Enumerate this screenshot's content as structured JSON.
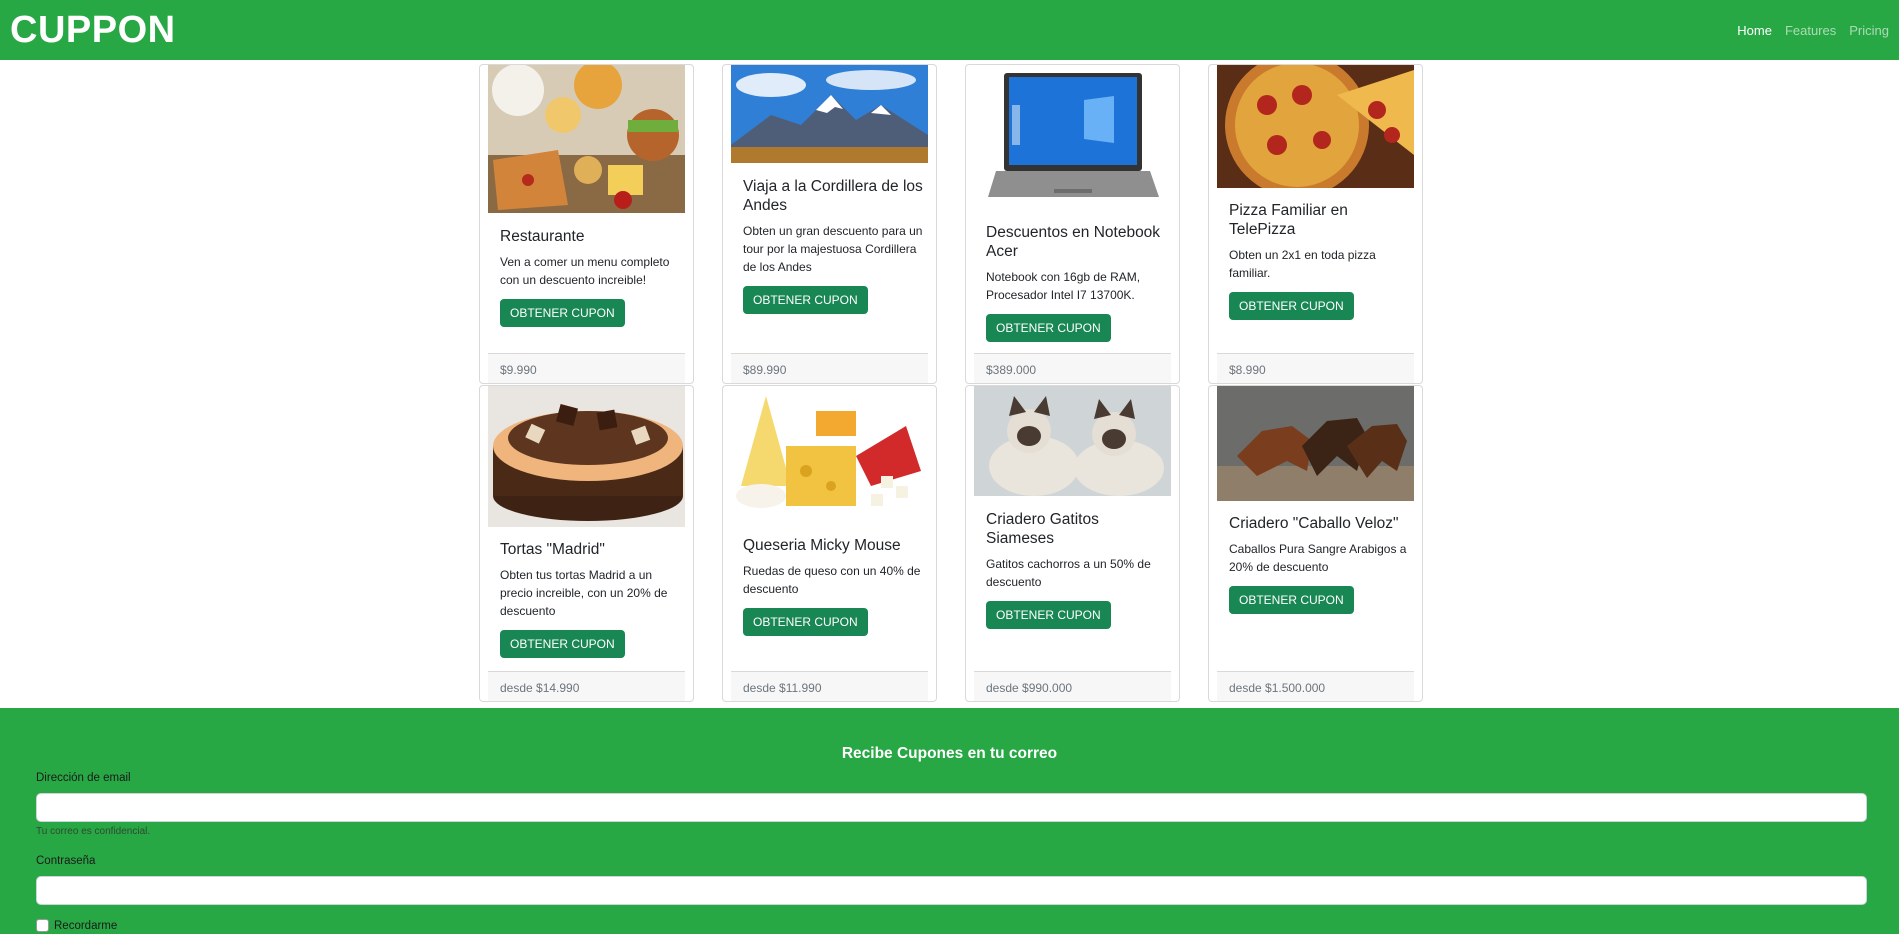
{
  "navbar": {
    "brand": "CUPPON",
    "links": [
      {
        "label": "Home"
      },
      {
        "label": "Features"
      },
      {
        "label": "Pricing"
      }
    ]
  },
  "cards": [
    {
      "title": "Restaurante",
      "text": "Ven a comer un menu completo con un descuento increible!",
      "button": "OBTENER CUPON",
      "price": "$9.990",
      "image": "fast-food-image"
    },
    {
      "title": "Viaja a la Cordillera de los Andes",
      "text": "Obten un gran descuento para un tour por la majestuosa Cordillera de los Andes",
      "button": "OBTENER CUPON",
      "price": "$89.990",
      "image": "mountain-image"
    },
    {
      "title": "Descuentos en Notebook Acer",
      "text": "Notebook con 16gb de RAM, Procesador Intel I7 13700K.",
      "button": "OBTENER CUPON",
      "price": "$389.000",
      "image": "laptop-image"
    },
    {
      "title": "Pizza Familiar en TelePizza",
      "text": "Obten un 2x1 en toda pizza familiar.",
      "button": "OBTENER CUPON",
      "price": "$8.990",
      "image": "pizza-image"
    },
    {
      "title": "Tortas \"Madrid\"",
      "text": "Obten tus tortas Madrid a un precio increible, con un 20% de descuento",
      "button": "OBTENER CUPON",
      "price": "desde $14.990",
      "image": "cake-image"
    },
    {
      "title": "Queseria Micky Mouse",
      "text": "Ruedas de queso con un 40% de descuento",
      "button": "OBTENER CUPON",
      "price": "desde $11.990",
      "image": "cheese-image"
    },
    {
      "title": "Criadero Gatitos Siameses",
      "text": "Gatitos cachorros a un 50% de descuento",
      "button": "OBTENER CUPON",
      "price": "desde $990.000",
      "image": "cats-image"
    },
    {
      "title": "Criadero \"Caballo Veloz\"",
      "text": "Caballos Pura Sangre Arabigos a 20% de descuento",
      "button": "OBTENER CUPON",
      "price": "desde $1.500.000",
      "image": "horses-image"
    }
  ],
  "newsletter": {
    "title": "Recibe Cupones en tu correo",
    "email_label": "Dirección de email",
    "email_value": "",
    "email_help": "Tu correo es confidencial.",
    "password_label": "Contraseña",
    "password_value": "",
    "remember_label": "Recordarme"
  },
  "colors": {
    "primary_green": "#28a745",
    "button_green": "#198754"
  }
}
